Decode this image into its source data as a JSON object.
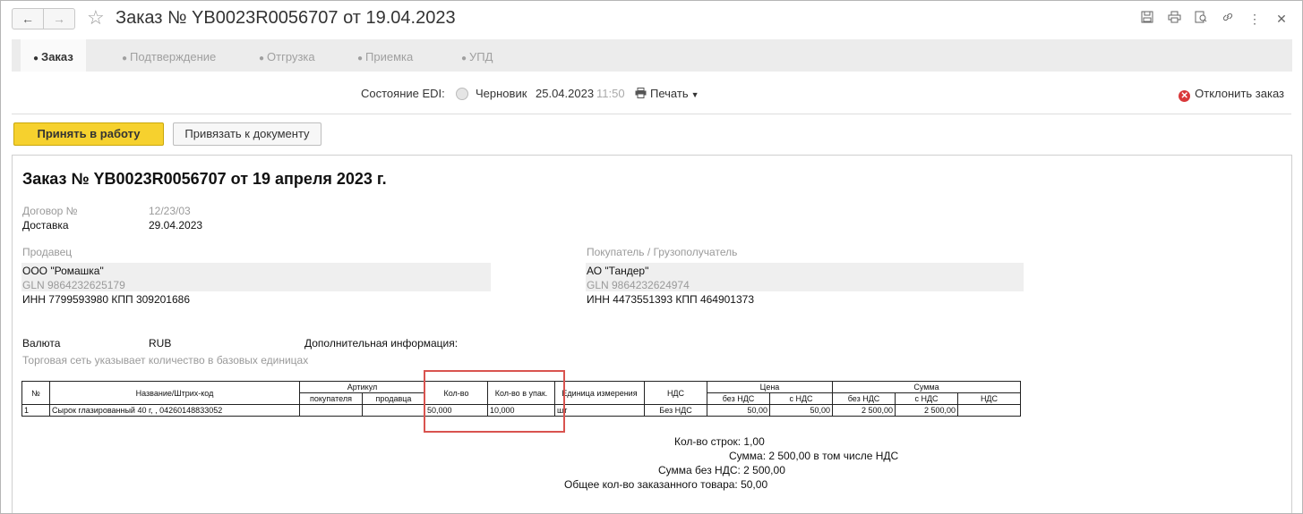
{
  "window": {
    "title": "Заказ № YB0023R0056707 от 19.04.2023",
    "nav": {
      "back": "←",
      "forward": "→"
    }
  },
  "toolbar_icons": [
    "save-icon",
    "print-icon",
    "preview-icon",
    "link-icon",
    "more-icon",
    "close-icon"
  ],
  "tabs": [
    {
      "label": "Заказ",
      "active": true
    },
    {
      "label": "Подтверждение"
    },
    {
      "label": "Отгрузка"
    },
    {
      "label": "Приемка"
    },
    {
      "label": "УПД"
    }
  ],
  "edi": {
    "label": "Состояние EDI:",
    "status": "Черновик",
    "date": "25.04.2023",
    "time": "11:50",
    "print": "Печать",
    "reject": "Отклонить заказ"
  },
  "actions": {
    "accept": "Принять в работу",
    "bind": "Привязать к документу"
  },
  "doc": {
    "title": "Заказ № YB0023R0056707 от 19 апреля 2023 г.",
    "contract_label": "Договор №",
    "contract_value": "12/23/03",
    "delivery_label": "Доставка",
    "delivery_value": "29.04.2023",
    "seller": {
      "heading": "Продавец",
      "name": "ООО \"Ромашка\"",
      "gln": "GLN 9864232625179",
      "inn": "ИНН 7799593980 КПП 309201686"
    },
    "buyer": {
      "heading": "Покупатель / Грузополучатель",
      "name": "АО \"Тандер\"",
      "gln": "GLN 9864232624974",
      "inn": "ИНН 4473551393 КПП 464901373"
    },
    "currency_label": "Валюта",
    "currency_value": "RUB",
    "extra_info_label": "Дополнительная информация:",
    "note": "Торговая сеть указывает количество в базовых единицах",
    "table": {
      "h_num": "№",
      "h_name": "Название/Штрих-код",
      "h_article": "Артикул",
      "h_article_buyer": "покупателя",
      "h_article_seller": "продавца",
      "h_qty": "Кол-во",
      "h_qty_pack": "Кол-во в упак.",
      "h_unit": "Единица измерения",
      "h_vat": "НДС",
      "h_price": "Цена",
      "h_price_novat": "без НДС",
      "h_price_vat": "с НДС",
      "h_sum": "Сумма",
      "h_sum_novat": "без НДС",
      "h_sum_vat": "с НДС",
      "h_sum_vatamt": "НДС",
      "rows": [
        {
          "num": "1",
          "name": "Сырок глазированный 40 г, , 04260148833052",
          "article_buyer": "",
          "article_seller": "",
          "qty": "50,000",
          "qty_pack": "10,000",
          "unit": "шт",
          "vat": "Без НДС",
          "price_novat": "50,00",
          "price_vat": "50,00",
          "sum_novat": "2 500,00",
          "sum_vat": "2 500,00",
          "sum_vatamt": ""
        }
      ]
    },
    "totals": {
      "rows_count": "Кол-во строк: 1,00",
      "sum": "Сумма: 2 500,00 в том числе НДС",
      "sum_novat": "Сумма без НДС: 2 500,00",
      "total_qty": "Общее кол-во заказанного товара: 50,00"
    }
  },
  "colors": {
    "primary_button": "#f6d12e",
    "reject_icon": "#d9383a",
    "highlight": "#d9534f"
  }
}
